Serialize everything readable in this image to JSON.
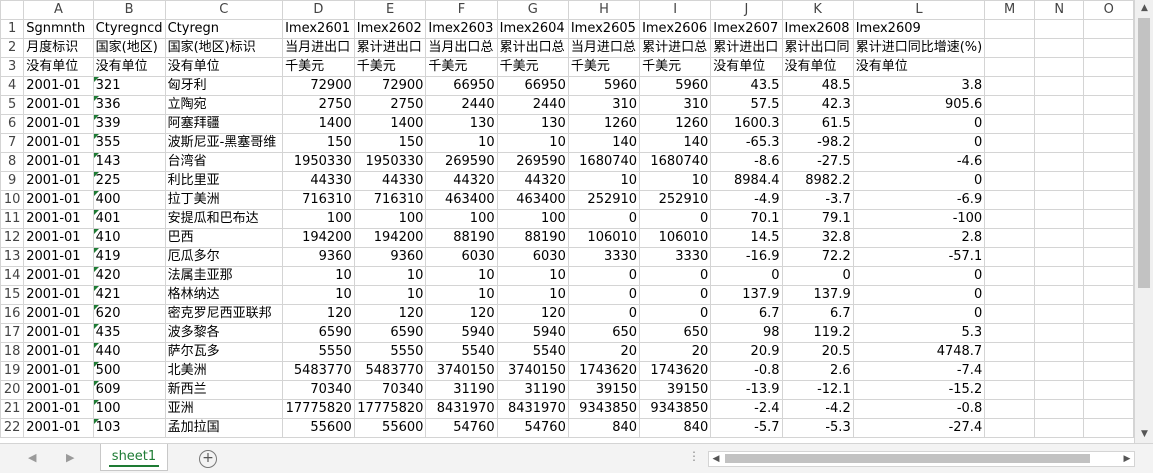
{
  "columns": [
    "A",
    "B",
    "C",
    "D",
    "E",
    "F",
    "G",
    "H",
    "I",
    "J",
    "K",
    "L",
    "M",
    "N",
    "O"
  ],
  "rows": [
    {
      "n": "1",
      "cells": [
        "Sgnmnth",
        "Ctyregncd",
        "Ctyregn",
        "Imex2601",
        "Imex2602",
        "Imex2603",
        "Imex2604",
        "Imex2605",
        "Imex2606",
        "Imex2607",
        "Imex2608",
        "Imex2609",
        "",
        "",
        ""
      ]
    },
    {
      "n": "2",
      "cells": [
        "月度标识",
        "国家(地区)",
        "国家(地区)标识",
        "当月进出口",
        "累计进出口",
        "当月出口总",
        "累计出口总",
        "当月进口总",
        "累计进口总",
        "累计进出口",
        "累计出口同",
        "累计进口同比增速(%)",
        "",
        "",
        ""
      ]
    },
    {
      "n": "3",
      "cells": [
        "没有单位",
        "没有单位",
        "没有单位",
        "千美元",
        "千美元",
        "千美元",
        "千美元",
        "千美元",
        "千美元",
        "没有单位",
        "没有单位",
        "没有单位",
        "",
        "",
        ""
      ]
    },
    {
      "n": "4",
      "cells": [
        "2001-01",
        "321",
        "匈牙利",
        "72900",
        "72900",
        "66950",
        "66950",
        "5960",
        "5960",
        "43.5",
        "48.5",
        "3.8",
        "",
        "",
        ""
      ]
    },
    {
      "n": "5",
      "cells": [
        "2001-01",
        "336",
        "立陶宛",
        "2750",
        "2750",
        "2440",
        "2440",
        "310",
        "310",
        "57.5",
        "42.3",
        "905.6",
        "",
        "",
        ""
      ]
    },
    {
      "n": "6",
      "cells": [
        "2001-01",
        "339",
        "阿塞拜疆",
        "1400",
        "1400",
        "130",
        "130",
        "1260",
        "1260",
        "1600.3",
        "61.5",
        "0",
        "",
        "",
        ""
      ]
    },
    {
      "n": "7",
      "cells": [
        "2001-01",
        "355",
        "波斯尼亚-黑塞哥维",
        "150",
        "150",
        "10",
        "10",
        "140",
        "140",
        "-65.3",
        "-98.2",
        "0",
        "",
        "",
        ""
      ]
    },
    {
      "n": "8",
      "cells": [
        "2001-01",
        "143",
        "台湾省",
        "1950330",
        "1950330",
        "269590",
        "269590",
        "1680740",
        "1680740",
        "-8.6",
        "-27.5",
        "-4.6",
        "",
        "",
        ""
      ]
    },
    {
      "n": "9",
      "cells": [
        "2001-01",
        "225",
        "利比里亚",
        "44330",
        "44330",
        "44320",
        "44320",
        "10",
        "10",
        "8984.4",
        "8982.2",
        "0",
        "",
        "",
        ""
      ]
    },
    {
      "n": "10",
      "cells": [
        "2001-01",
        "400",
        "拉丁美洲",
        "716310",
        "716310",
        "463400",
        "463400",
        "252910",
        "252910",
        "-4.9",
        "-3.7",
        "-6.9",
        "",
        "",
        ""
      ]
    },
    {
      "n": "11",
      "cells": [
        "2001-01",
        "401",
        "安提瓜和巴布达",
        "100",
        "100",
        "100",
        "100",
        "0",
        "0",
        "70.1",
        "79.1",
        "-100",
        "",
        "",
        ""
      ]
    },
    {
      "n": "12",
      "cells": [
        "2001-01",
        "410",
        "巴西",
        "194200",
        "194200",
        "88190",
        "88190",
        "106010",
        "106010",
        "14.5",
        "32.8",
        "2.8",
        "",
        "",
        ""
      ]
    },
    {
      "n": "13",
      "cells": [
        "2001-01",
        "419",
        "厄瓜多尔",
        "9360",
        "9360",
        "6030",
        "6030",
        "3330",
        "3330",
        "-16.9",
        "72.2",
        "-57.1",
        "",
        "",
        ""
      ]
    },
    {
      "n": "14",
      "cells": [
        "2001-01",
        "420",
        "法属圭亚那",
        "10",
        "10",
        "10",
        "10",
        "0",
        "0",
        "0",
        "0",
        "0",
        "",
        "",
        ""
      ]
    },
    {
      "n": "15",
      "cells": [
        "2001-01",
        "421",
        "格林纳达",
        "10",
        "10",
        "10",
        "10",
        "0",
        "0",
        "137.9",
        "137.9",
        "0",
        "",
        "",
        ""
      ]
    },
    {
      "n": "16",
      "cells": [
        "2001-01",
        "620",
        "密克罗尼西亚联邦",
        "120",
        "120",
        "120",
        "120",
        "0",
        "0",
        "6.7",
        "6.7",
        "0",
        "",
        "",
        ""
      ]
    },
    {
      "n": "17",
      "cells": [
        "2001-01",
        "435",
        "波多黎各",
        "6590",
        "6590",
        "5940",
        "5940",
        "650",
        "650",
        "98",
        "119.2",
        "5.3",
        "",
        "",
        ""
      ]
    },
    {
      "n": "18",
      "cells": [
        "2001-01",
        "440",
        "萨尔瓦多",
        "5550",
        "5550",
        "5540",
        "5540",
        "20",
        "20",
        "20.9",
        "20.5",
        "4748.7",
        "",
        "",
        ""
      ]
    },
    {
      "n": "19",
      "cells": [
        "2001-01",
        "500",
        "北美洲",
        "5483770",
        "5483770",
        "3740150",
        "3740150",
        "1743620",
        "1743620",
        "-0.8",
        "2.6",
        "-7.4",
        "",
        "",
        ""
      ]
    },
    {
      "n": "20",
      "cells": [
        "2001-01",
        "609",
        "新西兰",
        "70340",
        "70340",
        "31190",
        "31190",
        "39150",
        "39150",
        "-13.9",
        "-12.1",
        "-15.2",
        "",
        "",
        ""
      ]
    },
    {
      "n": "21",
      "cells": [
        "2001-01",
        "100",
        "亚洲",
        "17775820",
        "17775820",
        "8431970",
        "8431970",
        "9343850",
        "9343850",
        "-2.4",
        "-4.2",
        "-0.8",
        "",
        "",
        ""
      ]
    },
    {
      "n": "22",
      "cells": [
        "2001-01",
        "103",
        "孟加拉国",
        "55600",
        "55600",
        "54760",
        "54760",
        "840",
        "840",
        "-5.7",
        "-5.3",
        "-27.4",
        "",
        "",
        ""
      ]
    }
  ],
  "sheet_tab": "sheet1",
  "add_sheet": "+",
  "dots": "⋮",
  "arrows": {
    "left": "◀",
    "right": "▶",
    "up": "▲",
    "down": "▼"
  }
}
